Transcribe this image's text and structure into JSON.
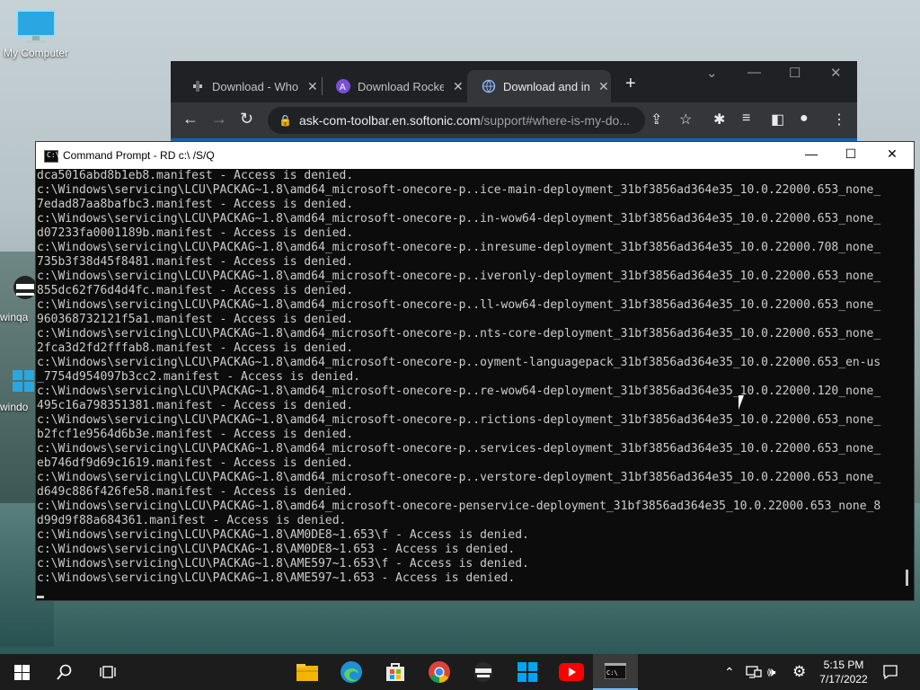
{
  "desktop": {
    "icons": [
      {
        "label": "My Computer",
        "icon": "monitor-icon"
      },
      {
        "label": "winqa",
        "icon": "mascot-icon"
      },
      {
        "label": "windo",
        "icon": "windows-icon"
      }
    ]
  },
  "browser": {
    "tabs": [
      {
        "title": "Download - Whois",
        "icon": "softonic-icon"
      },
      {
        "title": "Download Rocket",
        "icon": "rocket-a-icon"
      },
      {
        "title": "Download and ins",
        "icon": "globe-icon",
        "active": true
      }
    ],
    "url_host": "ask-com-toolbar.en.softonic.com",
    "url_path": "/support#where-is-my-do..."
  },
  "cmd": {
    "title": "Command Prompt - RD  c:\\ /S/Q",
    "lines": [
      "dca5016abd8b1eb8.manifest - Access is denied.",
      "c:\\Windows\\servicing\\LCU\\PACKAG~1.8\\amd64_microsoft-onecore-p..ice-main-deployment_31bf3856ad364e35_10.0.22000.653_none_",
      "7edad87aa8bafbc3.manifest - Access is denied.",
      "c:\\Windows\\servicing\\LCU\\PACKAG~1.8\\amd64_microsoft-onecore-p..in-wow64-deployment_31bf3856ad364e35_10.0.22000.653_none_",
      "d07233fa0001189b.manifest - Access is denied.",
      "c:\\Windows\\servicing\\LCU\\PACKAG~1.8\\amd64_microsoft-onecore-p..inresume-deployment_31bf3856ad364e35_10.0.22000.708_none_",
      "735b3f38d45f8481.manifest - Access is denied.",
      "c:\\Windows\\servicing\\LCU\\PACKAG~1.8\\amd64_microsoft-onecore-p..iveronly-deployment_31bf3856ad364e35_10.0.22000.653_none_",
      "855dc62f76d4d4fc.manifest - Access is denied.",
      "c:\\Windows\\servicing\\LCU\\PACKAG~1.8\\amd64_microsoft-onecore-p..ll-wow64-deployment_31bf3856ad364e35_10.0.22000.653_none_",
      "960368732121f5a1.manifest - Access is denied.",
      "c:\\Windows\\servicing\\LCU\\PACKAG~1.8\\amd64_microsoft-onecore-p..nts-core-deployment_31bf3856ad364e35_10.0.22000.653_none_",
      "2fca3d2fd2fffab8.manifest - Access is denied.",
      "c:\\Windows\\servicing\\LCU\\PACKAG~1.8\\amd64_microsoft-onecore-p..oyment-languagepack_31bf3856ad364e35_10.0.22000.653_en-us",
      "_7754d954097b3cc2.manifest - Access is denied.",
      "c:\\Windows\\servicing\\LCU\\PACKAG~1.8\\amd64_microsoft-onecore-p..re-wow64-deployment_31bf3856ad364e35_10.0.22000.120_none_",
      "495c16a798351381.manifest - Access is denied.",
      "c:\\Windows\\servicing\\LCU\\PACKAG~1.8\\amd64_microsoft-onecore-p..rictions-deployment_31bf3856ad364e35_10.0.22000.653_none_",
      "b2fcf1e9564d6b3e.manifest - Access is denied.",
      "c:\\Windows\\servicing\\LCU\\PACKAG~1.8\\amd64_microsoft-onecore-p..services-deployment_31bf3856ad364e35_10.0.22000.653_none_",
      "eb746df9d69c1619.manifest - Access is denied.",
      "c:\\Windows\\servicing\\LCU\\PACKAG~1.8\\amd64_microsoft-onecore-p..verstore-deployment_31bf3856ad364e35_10.0.22000.653_none_",
      "d649c886f426fe58.manifest - Access is denied.",
      "c:\\Windows\\servicing\\LCU\\PACKAG~1.8\\amd64_microsoft-onecore-penservice-deployment_31bf3856ad364e35_10.0.22000.653_none_8",
      "d99d9f88a684361.manifest - Access is denied.",
      "c:\\Windows\\servicing\\LCU\\PACKAG~1.8\\AM0DE8~1.653\\f - Access is denied.",
      "c:\\Windows\\servicing\\LCU\\PACKAG~1.8\\AM0DE8~1.653 - Access is denied.",
      "c:\\Windows\\servicing\\LCU\\PACKAG~1.8\\AME597~1.653\\f - Access is denied.",
      "c:\\Windows\\servicing\\LCU\\PACKAG~1.8\\AME597~1.653 - Access is denied."
    ]
  },
  "taskbar": {
    "apps": [
      {
        "name": "file-explorer-icon"
      },
      {
        "name": "edge-icon"
      },
      {
        "name": "store-icon"
      },
      {
        "name": "chrome-icon"
      },
      {
        "name": "mascot-app-icon"
      },
      {
        "name": "windows-logo-app-icon"
      },
      {
        "name": "youtube-icon"
      },
      {
        "name": "command-prompt-icon",
        "active": true
      }
    ],
    "time": "5:15 PM",
    "date": "7/17/2022"
  },
  "colors": {
    "taskbar": "#1c1c1c",
    "chrome_frame": "#202124",
    "console_bg": "#0c0c0c",
    "console_text": "#cccccc",
    "accent": "#76b9ed"
  }
}
